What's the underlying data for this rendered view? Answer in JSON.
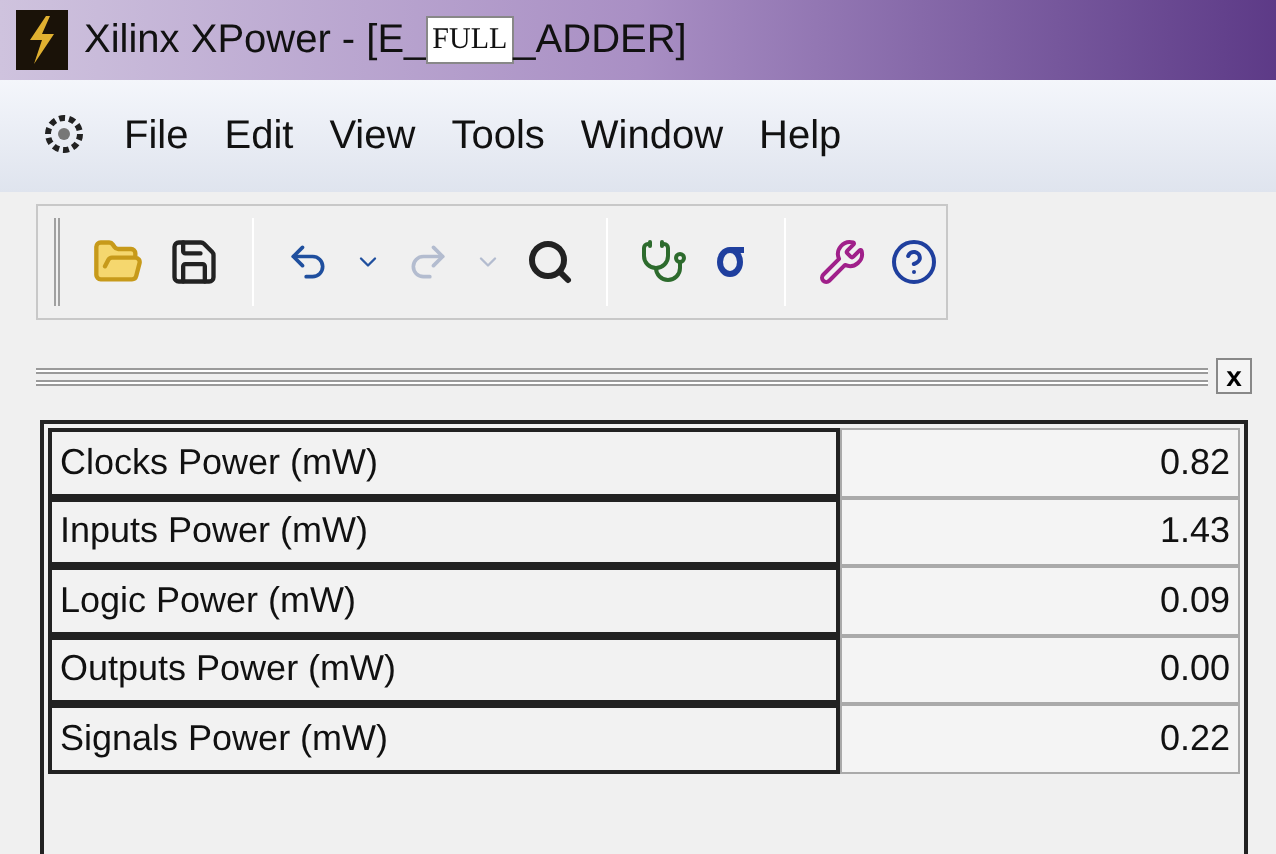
{
  "window": {
    "title_prefix": "Xilinx XPower - [E_",
    "title_box": "FULL",
    "title_suffix": "_ADDER]"
  },
  "menu": [
    "File",
    "Edit",
    "View",
    "Tools",
    "Window",
    "Help"
  ],
  "toolbar": {
    "redo_disabled": true
  },
  "table": {
    "rows": [
      {
        "label": "Clocks Power (mW)",
        "value": "0.82"
      },
      {
        "label": "Inputs Power (mW)",
        "value": "1.43"
      },
      {
        "label": "Logic Power (mW)",
        "value": "0.09"
      },
      {
        "label": "Outputs Power (mW)",
        "value": "0.00"
      },
      {
        "label": "Signals Power (mW)",
        "value": "0.22"
      }
    ]
  },
  "close_button": "x"
}
